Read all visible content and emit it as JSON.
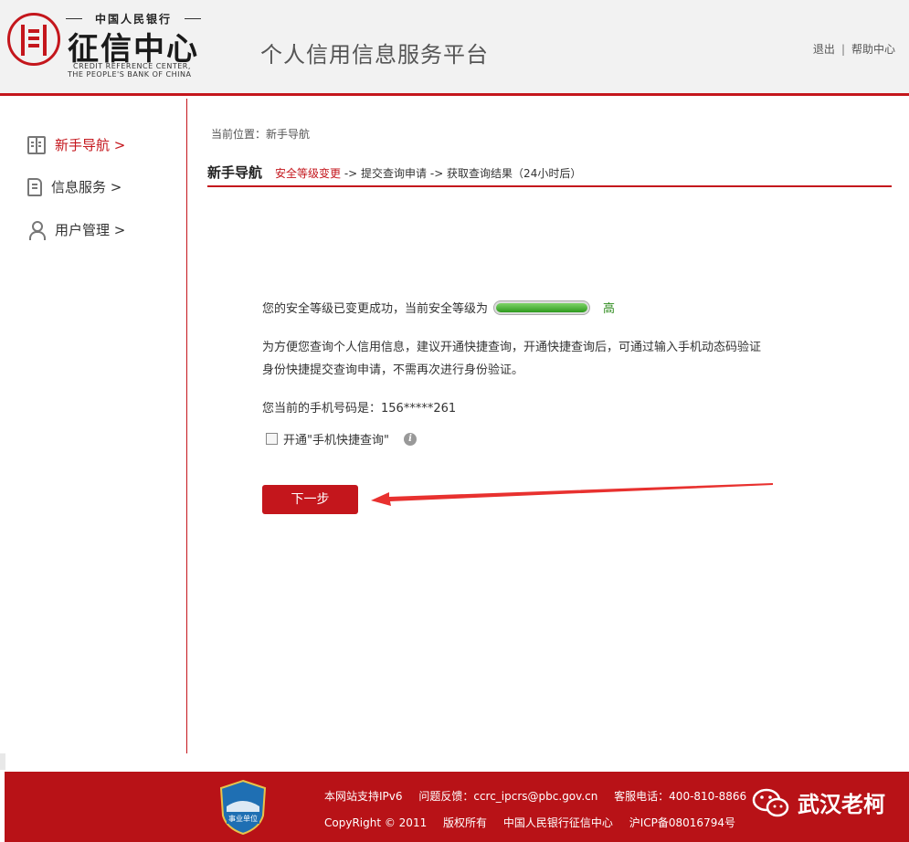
{
  "header": {
    "logo_top": "中国人民银行",
    "logo_main": "征信中心",
    "logo_en1": "CREDIT REFERENCE CENTER,",
    "logo_en2": "THE PEOPLE'S BANK OF CHINA",
    "site_title": "个人信用信息服务平台",
    "logout": "退出",
    "separator": "|",
    "help": "帮助中心"
  },
  "sidebar": {
    "items": [
      {
        "label": "新手导航 >",
        "icon": "book-icon",
        "active": true
      },
      {
        "label": "信息服务 >",
        "icon": "document-icon",
        "active": false
      },
      {
        "label": "用户管理 >",
        "icon": "user-icon",
        "active": false
      }
    ]
  },
  "main": {
    "breadcrumb": "当前位置：新手导航",
    "section_title": "新手导航",
    "steps": {
      "current": "安全等级变更",
      "rest": " -> 提交查询申请 -> 获取查询结果（24小时后）"
    },
    "security_msg": "您的安全等级已变更成功，当前安全等级为",
    "security_level": "高",
    "security_level_fraction": 1.0,
    "advice_line1": "为方便您查询个人信用信息，建议开通快捷查询，开通快捷查询后，可通过输入手机动态码验证",
    "advice_line2": "身份快捷提交查询申请，不需再次进行身份验证。",
    "phone_msg": "您当前的手机号码是：156*****261",
    "checkbox_label": "开通\"手机快捷查询\"",
    "checkbox_checked": false,
    "next_button": "下一步"
  },
  "footer": {
    "badge_text": "事业单位",
    "ipv6": "本网站支持IPv6",
    "feedback": "问题反馈：ccrc_ipcrs@pbc.gov.cn",
    "phone": "客服电话：400-810-8866",
    "copyright": "CopyRight © 2011",
    "rights": "版权所有",
    "org": "中国人民银行征信中心",
    "icp": "沪ICP备08016794号",
    "watermark": "武汉老柯"
  },
  "colors": {
    "brand_red": "#c4161c",
    "level_green": "#2e9a1d"
  }
}
